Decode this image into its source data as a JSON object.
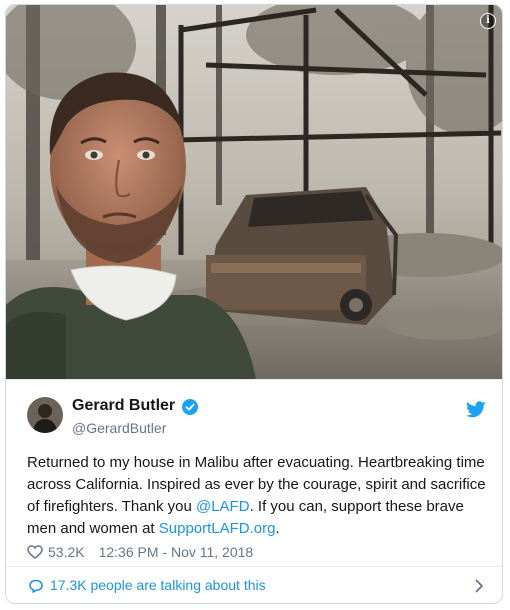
{
  "media": {
    "alt_icon": "info-icon",
    "info_symbol": "i"
  },
  "author": {
    "name": "Gerard Butler",
    "handle": "@GerardButler",
    "verified_icon": "verified-badge-icon"
  },
  "tweet": {
    "text_part1": "Returned to my house in Malibu after evacuating. Heartbreaking time across California. Inspired as ever by the courage, spirit and sacrifice of firefighters. Thank you ",
    "mention": "@LAFD",
    "text_part2": ". If you can, support these brave men and women at ",
    "link": "SupportLAFD.org",
    "text_part3": ".",
    "likes": "53.2K",
    "timestamp": "12:36 PM - Nov 11, 2018"
  },
  "footer": {
    "talking": "17.3K people are talking about this"
  },
  "colors": {
    "link": "#1b95e0",
    "text": "#14171a",
    "muted": "#657786",
    "border": "#e6ecf0"
  }
}
